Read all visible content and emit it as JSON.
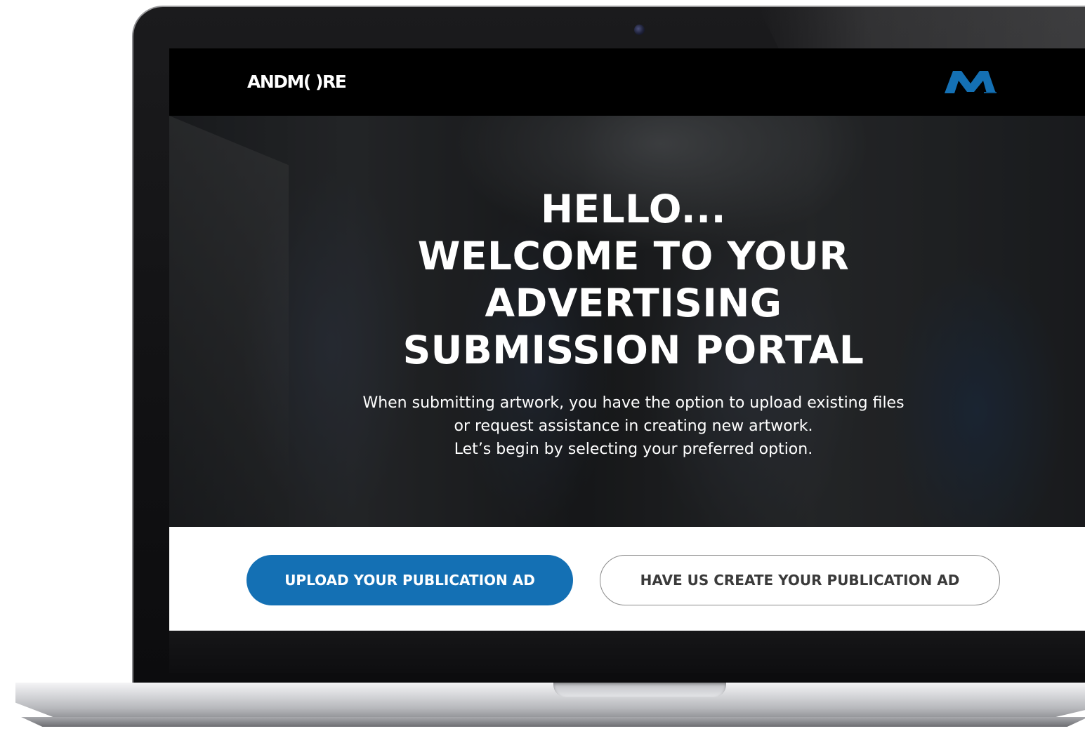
{
  "header": {
    "brand": "ANDM( )RE",
    "logo_icon": "m-logo-icon",
    "logo_color": "#1470b4"
  },
  "hero": {
    "title_lines": [
      "HELLO...",
      "WELCOME TO YOUR",
      "ADVERTISING",
      "SUBMISSION PORTAL"
    ],
    "subtitle_lines": [
      "When submitting artwork, you have the option to upload existing files",
      "or request assistance in creating new artwork.",
      "Let’s begin by selecting your preferred option."
    ]
  },
  "actions": {
    "upload_label": "UPLOAD YOUR PUBLICATION AD",
    "create_label": "HAVE US CREATE YOUR PUBLICATION AD",
    "primary_color": "#1470b4"
  }
}
